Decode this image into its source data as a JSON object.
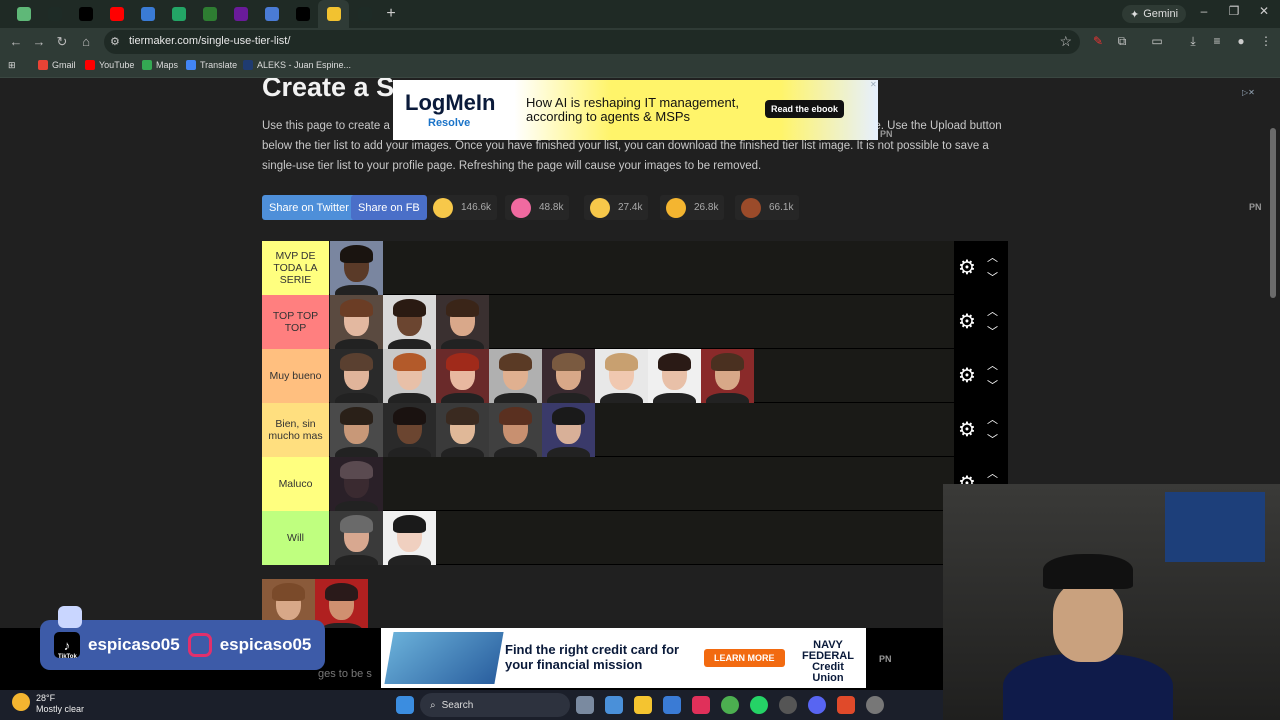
{
  "browser": {
    "tabs": [
      {
        "icon": "chrome-icon",
        "color": "#5fb878"
      },
      {
        "icon": "settings-tab-icon",
        "color": "#1e2b26"
      },
      {
        "icon": "tiktok-icon",
        "color": "#000000"
      },
      {
        "icon": "youtube-icon",
        "color": "#ff0000"
      },
      {
        "icon": "doc-icon",
        "color": "#3a7bd5"
      },
      {
        "icon": "sheets-icon",
        "color": "#23a566"
      },
      {
        "icon": "page-icon",
        "color": "#2e7d32"
      },
      {
        "icon": "purple-icon",
        "color": "#6a1b9a"
      },
      {
        "icon": "triangle-icon",
        "color": "#4a7bd5"
      },
      {
        "icon": "tiktok-icon",
        "color": "#000000"
      },
      {
        "icon": "tiermaker-icon",
        "color": "#f2c230"
      },
      {
        "icon": "settings-tab-icon",
        "color": "#1e2b26"
      }
    ],
    "new_tab": "+",
    "gemini_label": "Gemini",
    "url": "tiermaker.com/single-use-tier-list/",
    "bookmarks": [
      {
        "label": "Gmail",
        "color": "#ea4335"
      },
      {
        "label": "YouTube",
        "color": "#ff0000"
      },
      {
        "label": "Maps",
        "color": "#34a853"
      },
      {
        "label": "Translate",
        "color": "#4285f4"
      },
      {
        "label": "ALEKS - Juan Espine...",
        "color": "#1f3b70"
      }
    ]
  },
  "page": {
    "title": "Create a S",
    "description": "Use this page to create a single-use tier list. Your list will not be saved and will not be accessible anywhere on the website. Use the Upload button below the tier list to add your images. Once you have finished your list, you can download the finished tier list image. It is not possible to save a single-use tier list to your profile page. Refreshing the page will cause your images to be removed.",
    "share_twitter": "Share on Twitter",
    "share_fb": "Share on FB",
    "reactions": [
      {
        "count": "146.6k",
        "color": "#f7c84a"
      },
      {
        "count": "48.8k",
        "color": "#f06aa0"
      },
      {
        "count": "27.4k",
        "color": "#f7c84a"
      },
      {
        "count": "26.8k",
        "color": "#f4b530"
      },
      {
        "count": "66.1k",
        "color": "#9b4b2a"
      }
    ],
    "pn": "PN",
    "bottom_partial_text": "ges to be s"
  },
  "ad_top": {
    "brand": "LogMeIn",
    "sub": "Resolve",
    "message": "How AI is reshaping IT management, according to agents & MSPs",
    "cta": "Read the ebook"
  },
  "ad_bottom": {
    "message": "Find the right credit card for your financial mission",
    "cta": "LEARN MORE",
    "brand": "NAVY FEDERAL Credit Union"
  },
  "tiers": [
    {
      "label": "MVP DE TODA LA SERIE",
      "color": "#ffff7f",
      "faces": [
        {
          "skin": "#5a3a28",
          "hair": "#1a1410",
          "bg": "#7a86a0"
        }
      ]
    },
    {
      "label": "TOP TOP TOP",
      "color": "#ff7f7f",
      "faces": [
        {
          "skin": "#e3b8a0",
          "hair": "#6b3d25",
          "bg": "#5a4a40"
        },
        {
          "skin": "#6b4530",
          "hair": "#2a1a12",
          "bg": "#d9d9d9"
        },
        {
          "skin": "#d9a88a",
          "hair": "#3a2518",
          "bg": "#3a3030"
        }
      ]
    },
    {
      "label": "Muy bueno",
      "color": "#ffbf7f",
      "faces": [
        {
          "skin": "#e0b49a",
          "hair": "#5a4030",
          "bg": "#2a2a2a"
        },
        {
          "skin": "#e8c0a8",
          "hair": "#b35a2a",
          "bg": "#c9c9c9"
        },
        {
          "skin": "#e8b8a0",
          "hair": "#a02a1a",
          "bg": "#6a2a2a"
        },
        {
          "skin": "#e0b090",
          "hair": "#5a3a25",
          "bg": "#b0b0b0"
        },
        {
          "skin": "#d8a888",
          "hair": "#7a5a40",
          "bg": "#3a2a30"
        },
        {
          "skin": "#f0c8b0",
          "hair": "#c8a070",
          "bg": "#e8e8e8"
        },
        {
          "skin": "#e8c0a8",
          "hair": "#2a1a15",
          "bg": "#f0f0f0"
        },
        {
          "skin": "#d8a888",
          "hair": "#4a3020",
          "bg": "#8a2a2a"
        }
      ]
    },
    {
      "label": "Bien, sin mucho mas",
      "color": "#ffdf7f",
      "faces": [
        {
          "skin": "#c89878",
          "hair": "#2a2018",
          "bg": "#4a4a4a"
        },
        {
          "skin": "#6b4530",
          "hair": "#1a1210",
          "bg": "#2a2a2a"
        },
        {
          "skin": "#e0b898",
          "hair": "#3a2a20",
          "bg": "#3a3a3a"
        },
        {
          "skin": "#c89070",
          "hair": "#5a3020",
          "bg": "#404040"
        },
        {
          "skin": "#d8b098",
          "hair": "#1a1a1a",
          "bg": "#3a3a6a"
        }
      ]
    },
    {
      "label": "Maluco",
      "color": "#ffff7f",
      "faces": [
        {
          "skin": "#3a2a30",
          "hair": "#5a4a50",
          "bg": "#2a2028"
        }
      ]
    },
    {
      "label": "Will",
      "color": "#bfff7f",
      "faces": [
        {
          "skin": "#d8a890",
          "hair": "#6a6a6a",
          "bg": "#3a3a3a"
        },
        {
          "skin": "#f0d0c0",
          "hair": "#1a1a1a",
          "bg": "#f0f0f0"
        }
      ]
    }
  ],
  "pool": [
    {
      "skin": "#d8a888",
      "hair": "#7a4a2a",
      "bg": "#8a5a3a"
    },
    {
      "skin": "#d09070",
      "hair": "#2a1a1a",
      "bg": "#b02020"
    }
  ],
  "social": {
    "tiktok_handle": "espicaso05",
    "instagram_handle": "espicaso05",
    "tiktok_label": "TikTok"
  },
  "taskbar": {
    "temperature": "28°F",
    "condition": "Mostly clear",
    "search_placeholder": "Search"
  }
}
